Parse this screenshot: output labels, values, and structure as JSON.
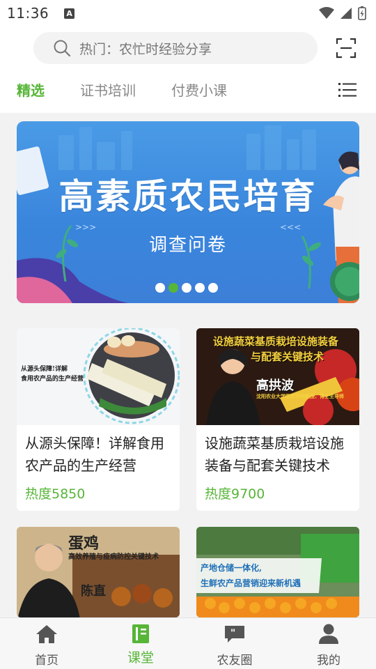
{
  "status_bar": {
    "time": "11:36",
    "notification_icon": "a-letter-icon"
  },
  "search": {
    "placeholder": "热门：农忙时经验分享"
  },
  "tabs": [
    {
      "label": "精选",
      "active": true
    },
    {
      "label": "证书培训",
      "active": false
    },
    {
      "label": "付费小课",
      "active": false
    }
  ],
  "banner": {
    "title": "高素质农民培育",
    "subtitle": "调查问卷",
    "slide_count": 5,
    "active_slide": 2
  },
  "cards": [
    {
      "thumb_text": [
        "从源头保障!详解",
        "食用农产品的生产经营"
      ],
      "title": "从源头保障！详解食用农产品的生产经营",
      "heat": "热度5850"
    },
    {
      "thumb_text": [
        "设施蔬菜基质栽培设施装备",
        "与配套关键技术",
        "高拱波",
        "沈阳农业大学园艺学院教授、博士生导师"
      ],
      "title": "设施蔬菜基质栽培设施装备与配套关键技术",
      "heat": "热度9700"
    },
    {
      "thumb_text": [
        "蛋鸡",
        "高效养殖与疫病防控关键技术",
        "陈直"
      ],
      "title": "",
      "heat": ""
    },
    {
      "thumb_text": [
        "产地仓储一体化,",
        "生鲜农产品营销迎来新机遇"
      ],
      "title": "",
      "heat": ""
    }
  ],
  "bottom_nav": [
    {
      "label": "首页",
      "icon": "home-icon",
      "active": false
    },
    {
      "label": "课堂",
      "icon": "book-icon",
      "active": true
    },
    {
      "label": "农友圈",
      "icon": "chat-quote-icon",
      "active": false
    },
    {
      "label": "我的",
      "icon": "person-icon",
      "active": false
    }
  ],
  "colors": {
    "accent": "#57b538",
    "banner_blue": "#3a86dd"
  }
}
